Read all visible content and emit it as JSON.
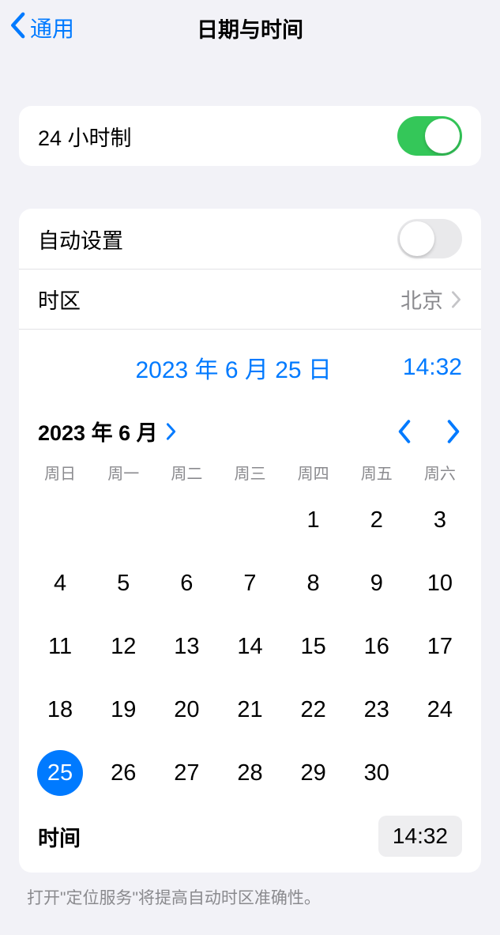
{
  "nav": {
    "back_label": "通用",
    "title": "日期与时间"
  },
  "rows": {
    "twenty_four_hour_label": "24 小时制",
    "twenty_four_hour_on": true,
    "auto_set_label": "自动设置",
    "auto_set_on": false,
    "timezone_label": "时区",
    "timezone_value": "北京"
  },
  "datetime": {
    "date_display": "2023 年 6 月 25 日",
    "time_display": "14:32"
  },
  "calendar": {
    "month_label": "2023 年 6 月",
    "weekdays": [
      "周日",
      "周一",
      "周二",
      "周三",
      "周四",
      "周五",
      "周六"
    ],
    "first_weekday_index": 4,
    "days_in_month": 30,
    "selected_day": 25,
    "time_row_label": "时间",
    "time_value": "14:32"
  },
  "footer_hint": "打开\"定位服务\"将提高自动时区准确性。"
}
